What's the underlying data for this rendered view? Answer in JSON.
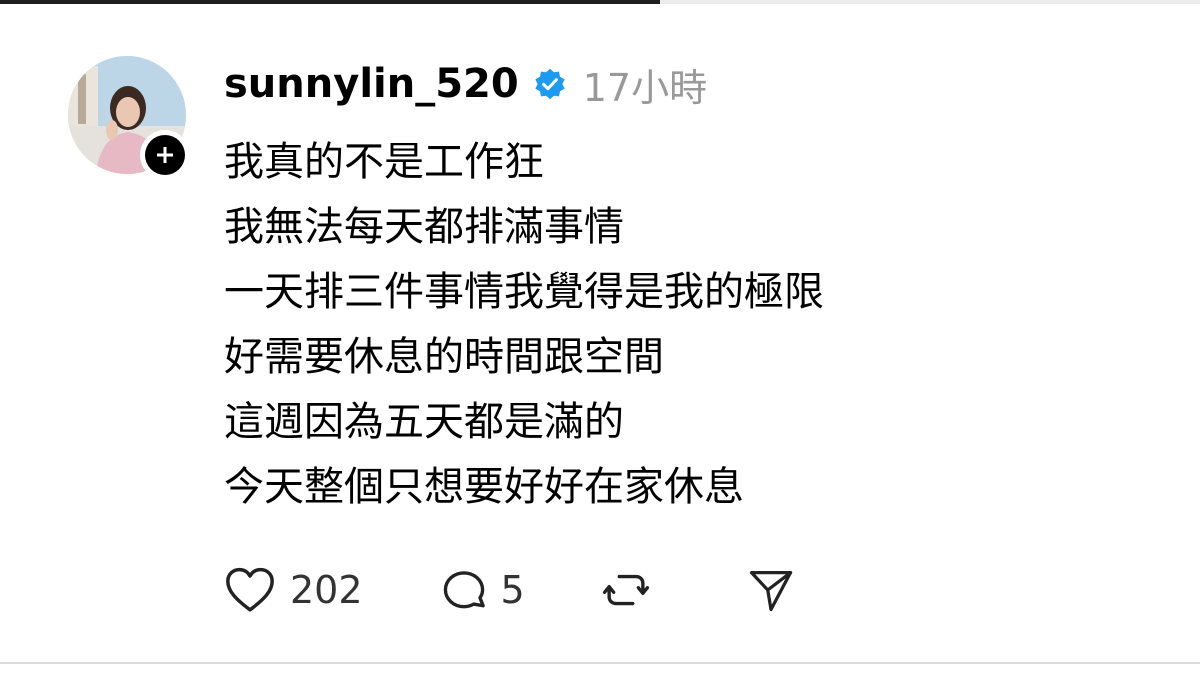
{
  "post": {
    "username": "sunnylin_520",
    "timestamp": "17小時",
    "lines": [
      "我真的不是工作狂",
      "我無法每天都排滿事情",
      "一天排三件事情我覺得是我的極限",
      "好需要休息的時間跟空間",
      "這週因為五天都是滿的",
      "今天整個只想要好好在家休息"
    ]
  },
  "actions": {
    "like_count": "202",
    "comment_count": "5"
  },
  "icons": {
    "verified": "verified-badge-icon",
    "follow": "plus-icon",
    "like": "heart-icon",
    "comment": "comment-bubble-icon",
    "repost": "repost-icon",
    "share": "send-icon"
  },
  "colors": {
    "verified_blue": "#1d9bf0",
    "timestamp_gray": "#999999",
    "text": "#000000"
  }
}
